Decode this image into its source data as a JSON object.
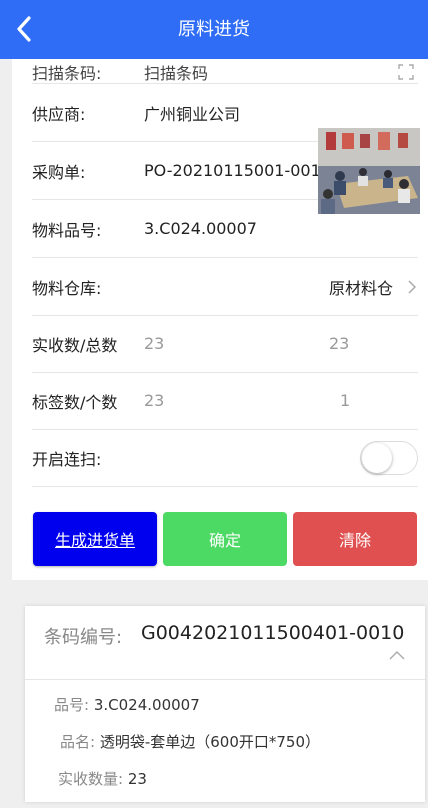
{
  "header": {
    "title": "原料进货"
  },
  "form": {
    "scanned_row": {
      "label": "扫描条码:",
      "value": "扫描条码"
    },
    "supplier": {
      "label": "供应商:",
      "value": "广州铜业公司"
    },
    "po": {
      "label": "采购单:",
      "value": "PO-20210115001-001"
    },
    "item_no": {
      "label": "物料品号:",
      "value": "3.C024.00007"
    },
    "warehouse": {
      "label": "物料仓库:",
      "value": "原材料仓"
    },
    "received_total": {
      "label": "实收数/总数",
      "received": "23",
      "total": "23"
    },
    "labels_count": {
      "label": "标签数/个数",
      "labels": "23",
      "count": "1"
    },
    "continuous_scan": {
      "label": "开启连扫:",
      "enabled": false
    }
  },
  "buttons": {
    "generate": "生成进货单",
    "confirm": "确定",
    "clear": "清除"
  },
  "barcode_card": {
    "label": "条码编号:",
    "value": "G0042021011500401-0010",
    "item_no_label": "品号:",
    "item_no": "3.C024.00007",
    "item_name_label": "品名:",
    "item_name": "透明袋-套单边（600开口*750）",
    "qty_label": "实收数量:",
    "qty": "23"
  },
  "colors": {
    "header": "#2f6df6",
    "generate": "#0000ee",
    "confirm": "#4cd964",
    "clear": "#e05050"
  },
  "icons": {
    "back": "chevron-left-icon",
    "arrow": "chevron-right-icon",
    "collapse": "chevron-up-icon",
    "scan": "scan-icon"
  }
}
